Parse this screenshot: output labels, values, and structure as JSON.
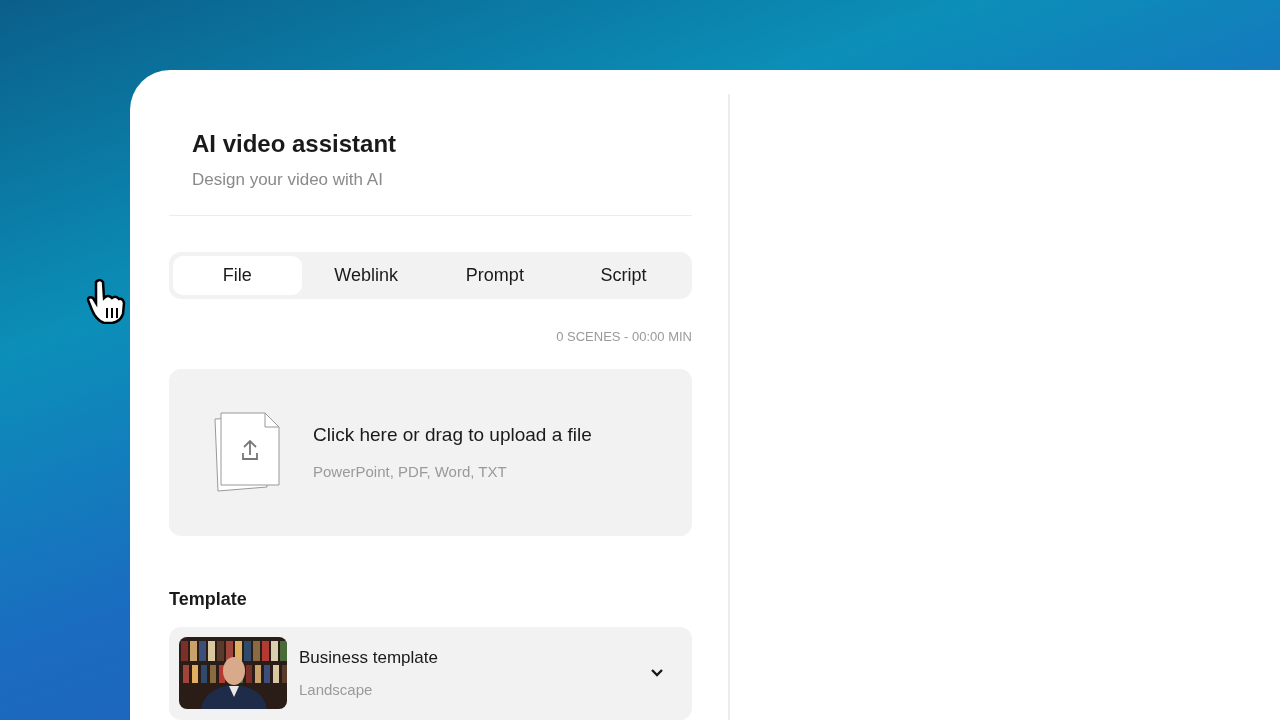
{
  "panel": {
    "title": "AI video assistant",
    "subtitle": "Design your video with AI"
  },
  "tabs": [
    {
      "label": "File",
      "selected": true
    },
    {
      "label": "Weblink",
      "selected": false
    },
    {
      "label": "Prompt",
      "selected": false
    },
    {
      "label": "Script",
      "selected": false
    }
  ],
  "summary": "0 SCENES - 00:00 MIN",
  "upload": {
    "title": "Click here or drag to upload a file",
    "formats": "PowerPoint, PDF, Word, TXT"
  },
  "template": {
    "label": "Template",
    "name": "Business template",
    "orientation": "Landscape"
  }
}
